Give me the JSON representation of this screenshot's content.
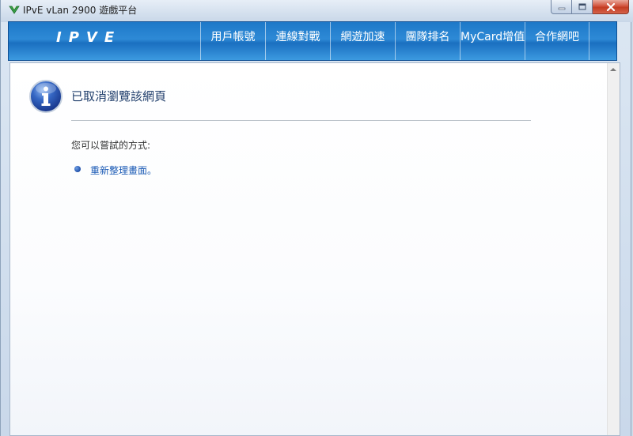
{
  "window": {
    "title": "IPvE vLan 2900 遊戲平台"
  },
  "nav": {
    "logo_text": "IPVE",
    "tabs": [
      {
        "label": "用戶帳號"
      },
      {
        "label": "連線對戰"
      },
      {
        "label": "網遊加速"
      },
      {
        "label": "團隊排名"
      },
      {
        "label": "MyCard增值"
      },
      {
        "label": "合作網吧"
      }
    ]
  },
  "page": {
    "heading": "已取消瀏覽該網頁",
    "try_label": "您可以嘗試的方式:",
    "refresh_link": "重新整理畫面",
    "refresh_suffix": "。"
  },
  "icons": {
    "app": "app-icon",
    "info": "info-icon",
    "minimize": "minimize-icon",
    "maximize": "maximize-icon",
    "close": "close-icon"
  },
  "colors": {
    "nav_blue": "#1d78c8",
    "link_blue": "#1b5bb5",
    "close_red": "#c33c22"
  }
}
